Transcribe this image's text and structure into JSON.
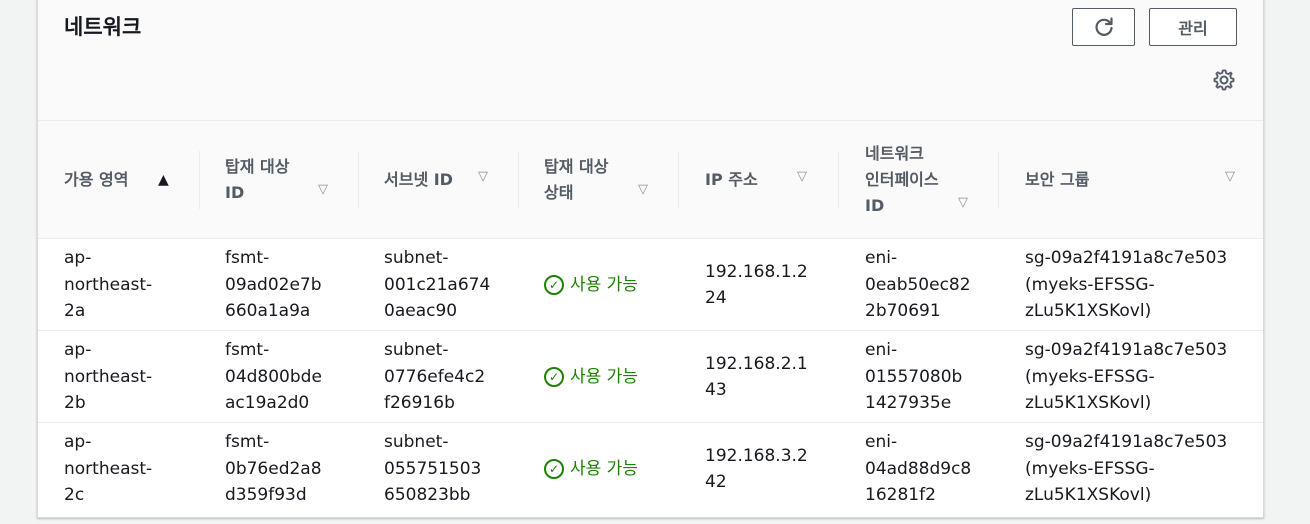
{
  "header": {
    "title": "네트워크",
    "manage_label": "관리",
    "refresh_icon": "refresh-icon",
    "settings_icon": "gear-icon"
  },
  "columns": [
    {
      "label": "가용 영역",
      "sort": "▲"
    },
    {
      "label": "탑재 대상\nID",
      "sort": "▽"
    },
    {
      "label": "서브넷 ID",
      "sort": "▽"
    },
    {
      "label": "탑재 대상\n상태",
      "sort": "▽"
    },
    {
      "label": "IP 주소",
      "sort": "▽"
    },
    {
      "label": "네트워크\n인터페이스\nID",
      "sort": "▽"
    },
    {
      "label": "보안 그룹",
      "sort": "▽"
    }
  ],
  "rows": [
    {
      "az": "ap-\nnortheast-\n2a",
      "mount_id": "fsmt-\n09ad02e7b\n660a1a9a",
      "subnet": "subnet-\n001c21a674\n0aeac90",
      "status": "사용 가능",
      "ip": "192.168.1.2\n24",
      "eni": "eni-\n0eab50ec82\n2b70691",
      "sg": "sg-09a2f4191a8c7e503\n(myeks-EFSSG-\nzLu5K1XSKovl)"
    },
    {
      "az": "ap-\nnortheast-\n2b",
      "mount_id": "fsmt-\n04d800bde\nac19a2d0",
      "subnet": "subnet-\n0776efe4c2\nf26916b",
      "status": "사용 가능",
      "ip": "192.168.2.1\n43",
      "eni": "eni-\n01557080b\n1427935e",
      "sg": "sg-09a2f4191a8c7e503\n(myeks-EFSSG-\nzLu5K1XSKovl)"
    },
    {
      "az": "ap-\nnortheast-\n2c",
      "mount_id": "fsmt-\n0b76ed2a8\nd359f93d",
      "subnet": "subnet-\n055751503\n650823bb",
      "status": "사용 가능",
      "ip": "192.168.3.2\n42",
      "eni": "eni-\n04ad88d9c8\n16281f2",
      "sg": "sg-09a2f4191a8c7e503\n(myeks-EFSSG-\nzLu5K1XSKovl)"
    }
  ],
  "colors": {
    "status_ok": "#1d8102",
    "header_bg": "#fafafa",
    "border": "#eaeded"
  }
}
